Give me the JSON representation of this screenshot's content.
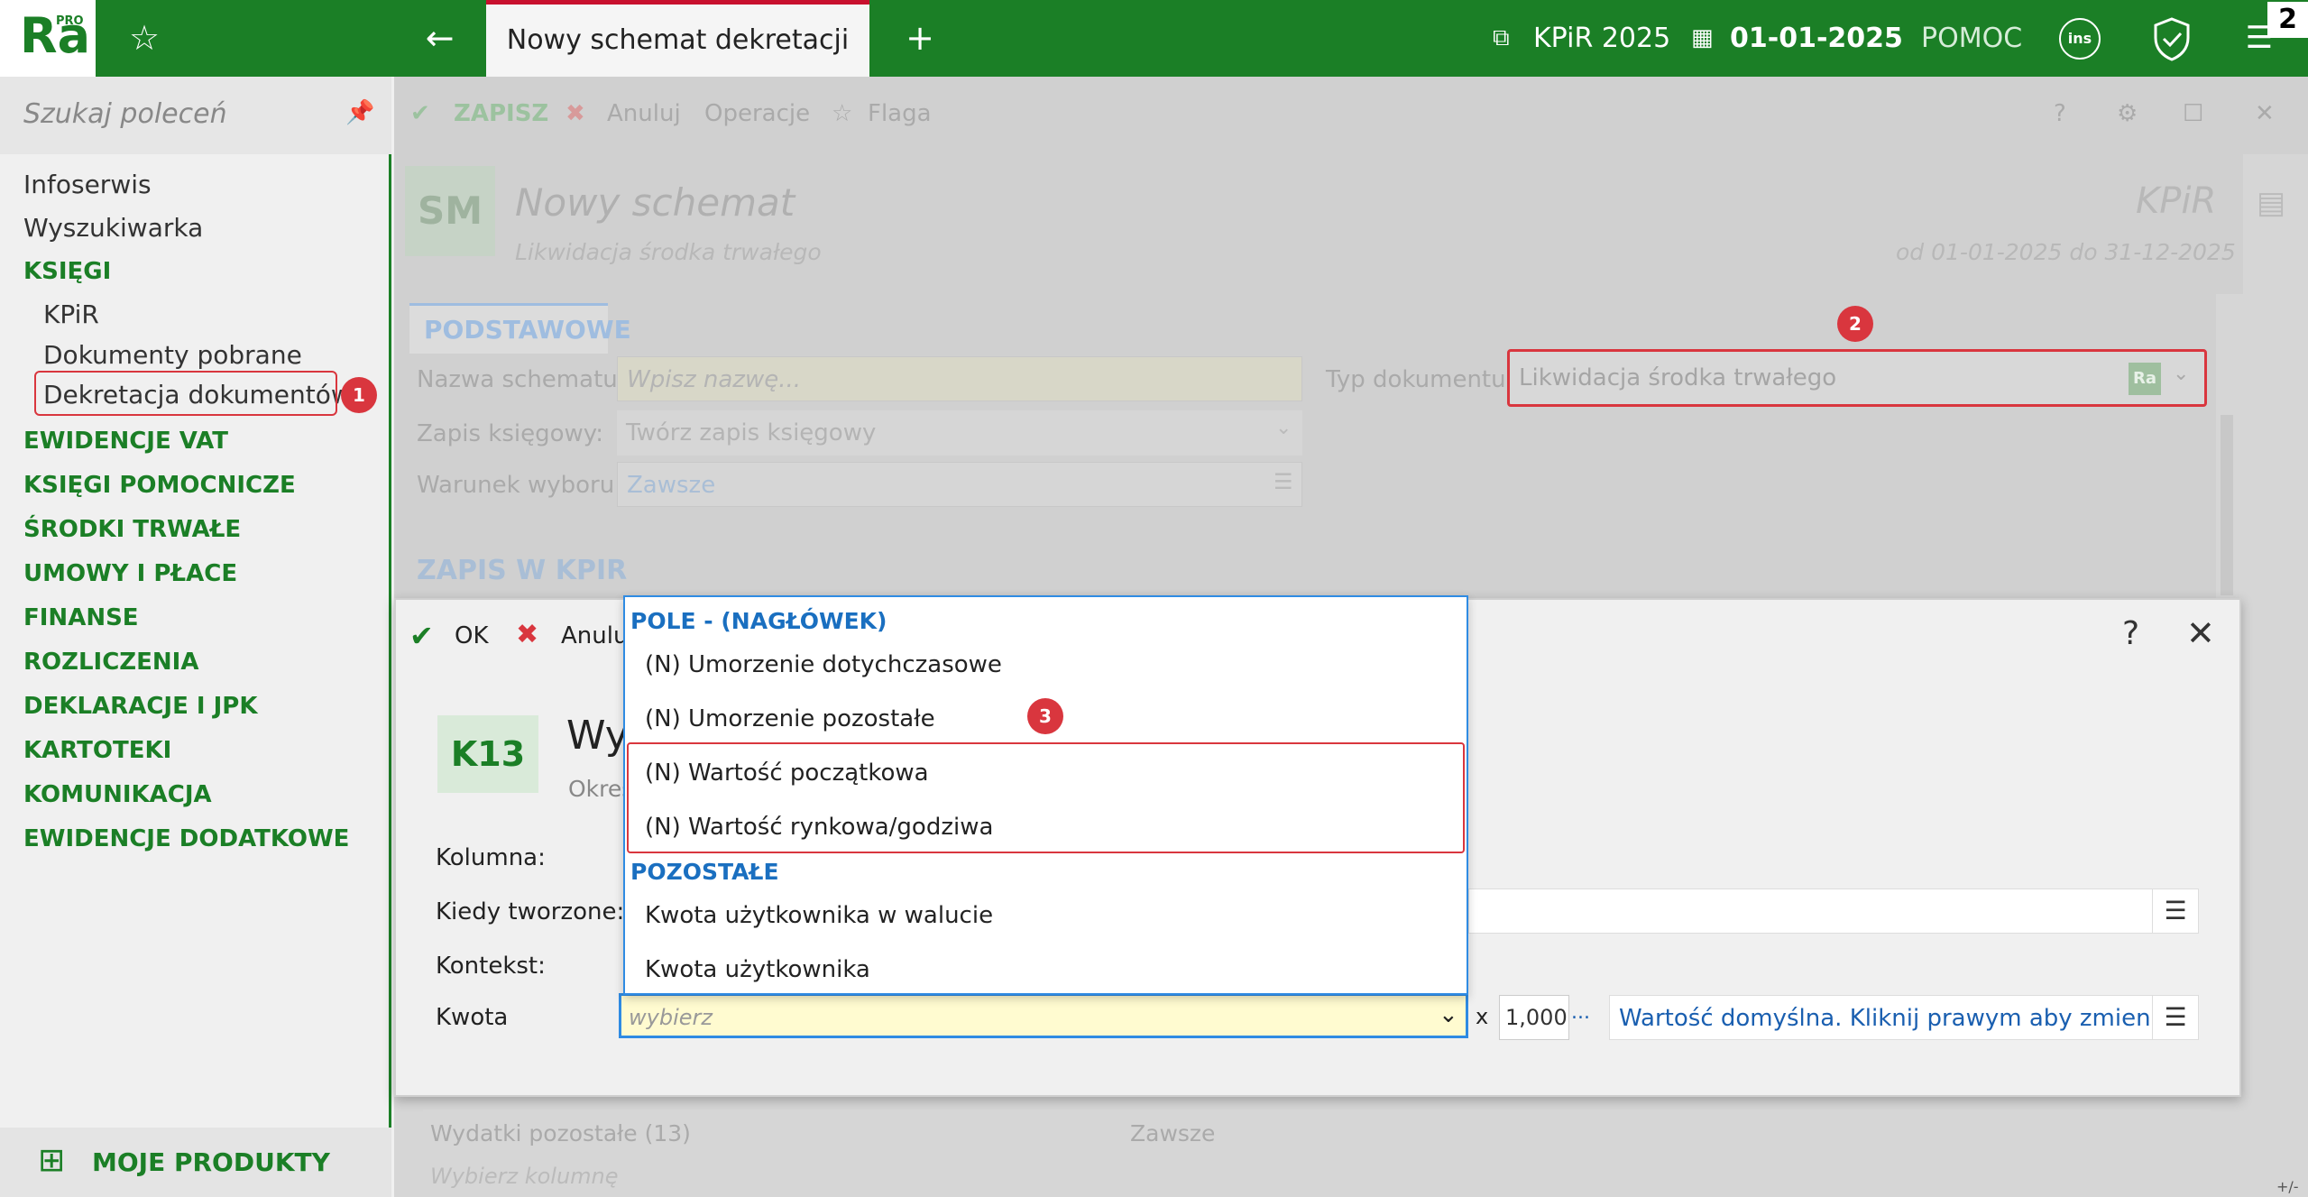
{
  "app": {
    "logo": "Ra",
    "logo_pro": "PRO",
    "tab_title": "Nowy schemat dekretacji",
    "book": "KPiR 2025",
    "date": "01-01-2025",
    "help": "POMOC",
    "ins_label": "ins",
    "badge_count": "2"
  },
  "sidebar": {
    "search_placeholder": "Szukaj poleceń",
    "items": [
      "Infoserwis",
      "Wyszukiwarka",
      "KSIĘGI",
      "KPiR",
      "Dokumenty pobrane",
      "Dekretacja dokumentów",
      "EWIDENCJE VAT",
      "KSIĘGI POMOCNICZE",
      "ŚRODKI TRWAŁE",
      "UMOWY I PŁACE",
      "FINANSE",
      "ROZLICZENIA",
      "DEKLARACJE I JPK",
      "KARTOTEKI",
      "KOMUNIKACJA",
      "EWIDENCJE DODATKOWE"
    ],
    "my_products": "MOJE PRODUKTY"
  },
  "callouts": {
    "one": "1",
    "two": "2",
    "three": "3"
  },
  "toolbar": {
    "save": "ZAPISZ",
    "cancel": "Anuluj",
    "operations": "Operacje",
    "flag": "Flaga"
  },
  "header": {
    "sm": "SM",
    "title": "Nowy schemat",
    "subtitle": "Likwidacja środka trwałego",
    "book": "KPiR",
    "period": "od 01-01-2025 do 31-12-2025"
  },
  "form": {
    "tab": "PODSTAWOWE",
    "name_label": "Nazwa schematu:",
    "name_placeholder": "Wpisz nazwę...",
    "doc_type_label": "Typ dokumentu:",
    "doc_type_value": "Likwidacja środka trwałego",
    "doc_type_tag": "Ra",
    "entry_label": "Zapis księgowy:",
    "entry_value": "Twórz zapis księgowy",
    "cond_label": "Warunek wyboru:",
    "cond_value": "Zawsze",
    "section": "ZAPIS W KPIR"
  },
  "dialog": {
    "ok": "OK",
    "cancel": "Anulu",
    "help": "?",
    "code": "K13",
    "title": "Wy",
    "subtitle": "Okres",
    "column_label": "Kolumna:",
    "when_label": "Kiedy tworzone:",
    "context_label": "Kontekst:",
    "amount_label": "Kwota",
    "amount_placeholder": "wybierz",
    "multiplier_x": "x",
    "multiplier": "1,000",
    "multiplier_more": "...",
    "default_text": "Wartość domyślna. Kliknij prawym aby zmienić."
  },
  "dropdown": {
    "group1": "POLE - (NAGŁÓWEK)",
    "items1": [
      "(N) Umorzenie dotychczasowe",
      "(N) Umorzenie pozostałe",
      "(N) Wartość początkowa",
      "(N) Wartość rynkowa/godziwa"
    ],
    "group2": "POZOSTAŁE",
    "items2": [
      "Kwota użytkownika w walucie",
      "Kwota użytkownika"
    ]
  },
  "bottom": {
    "col1": "Wydatki pozostałe (13)",
    "col2": "Zawsze",
    "col1b": "Wybierz kolumnę",
    "corner": "+/-"
  }
}
